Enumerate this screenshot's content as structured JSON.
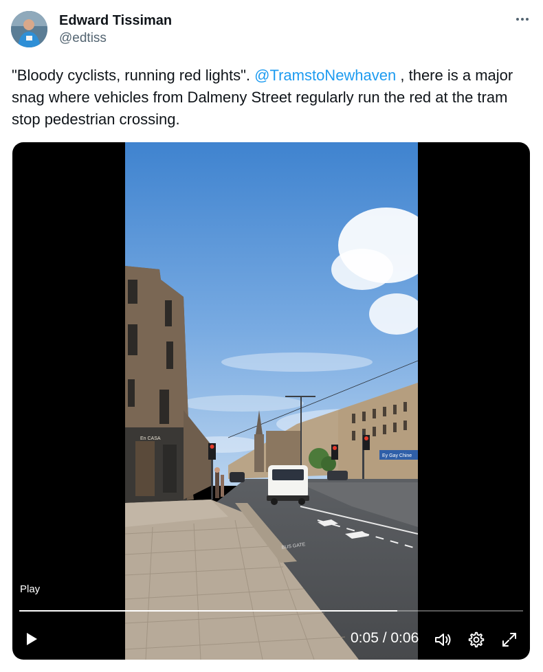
{
  "author": {
    "name": "Edward Tissiman",
    "handle": "@edtiss"
  },
  "tweet": {
    "text_before": "\"Bloody cyclists, running red lights\". ",
    "mention": "@TramstoNewhaven",
    "text_after": " , there is a major snag where vehicles from Dalmeny Street regularly run the red at the tram stop pedestrian crossing."
  },
  "video": {
    "play_label": "Play",
    "time_display": "0:05 / 0:06",
    "progress": 0.75,
    "shopfront_sign": "Ey Gay Chine"
  },
  "icons": {
    "more": "more-horizontal-icon",
    "play": "play-icon",
    "volume": "volume-icon",
    "settings": "gear-icon",
    "fullscreen": "fullscreen-icon"
  },
  "colors": {
    "link": "#1d9bf0",
    "text": "#0f1419",
    "muted": "#536471"
  }
}
